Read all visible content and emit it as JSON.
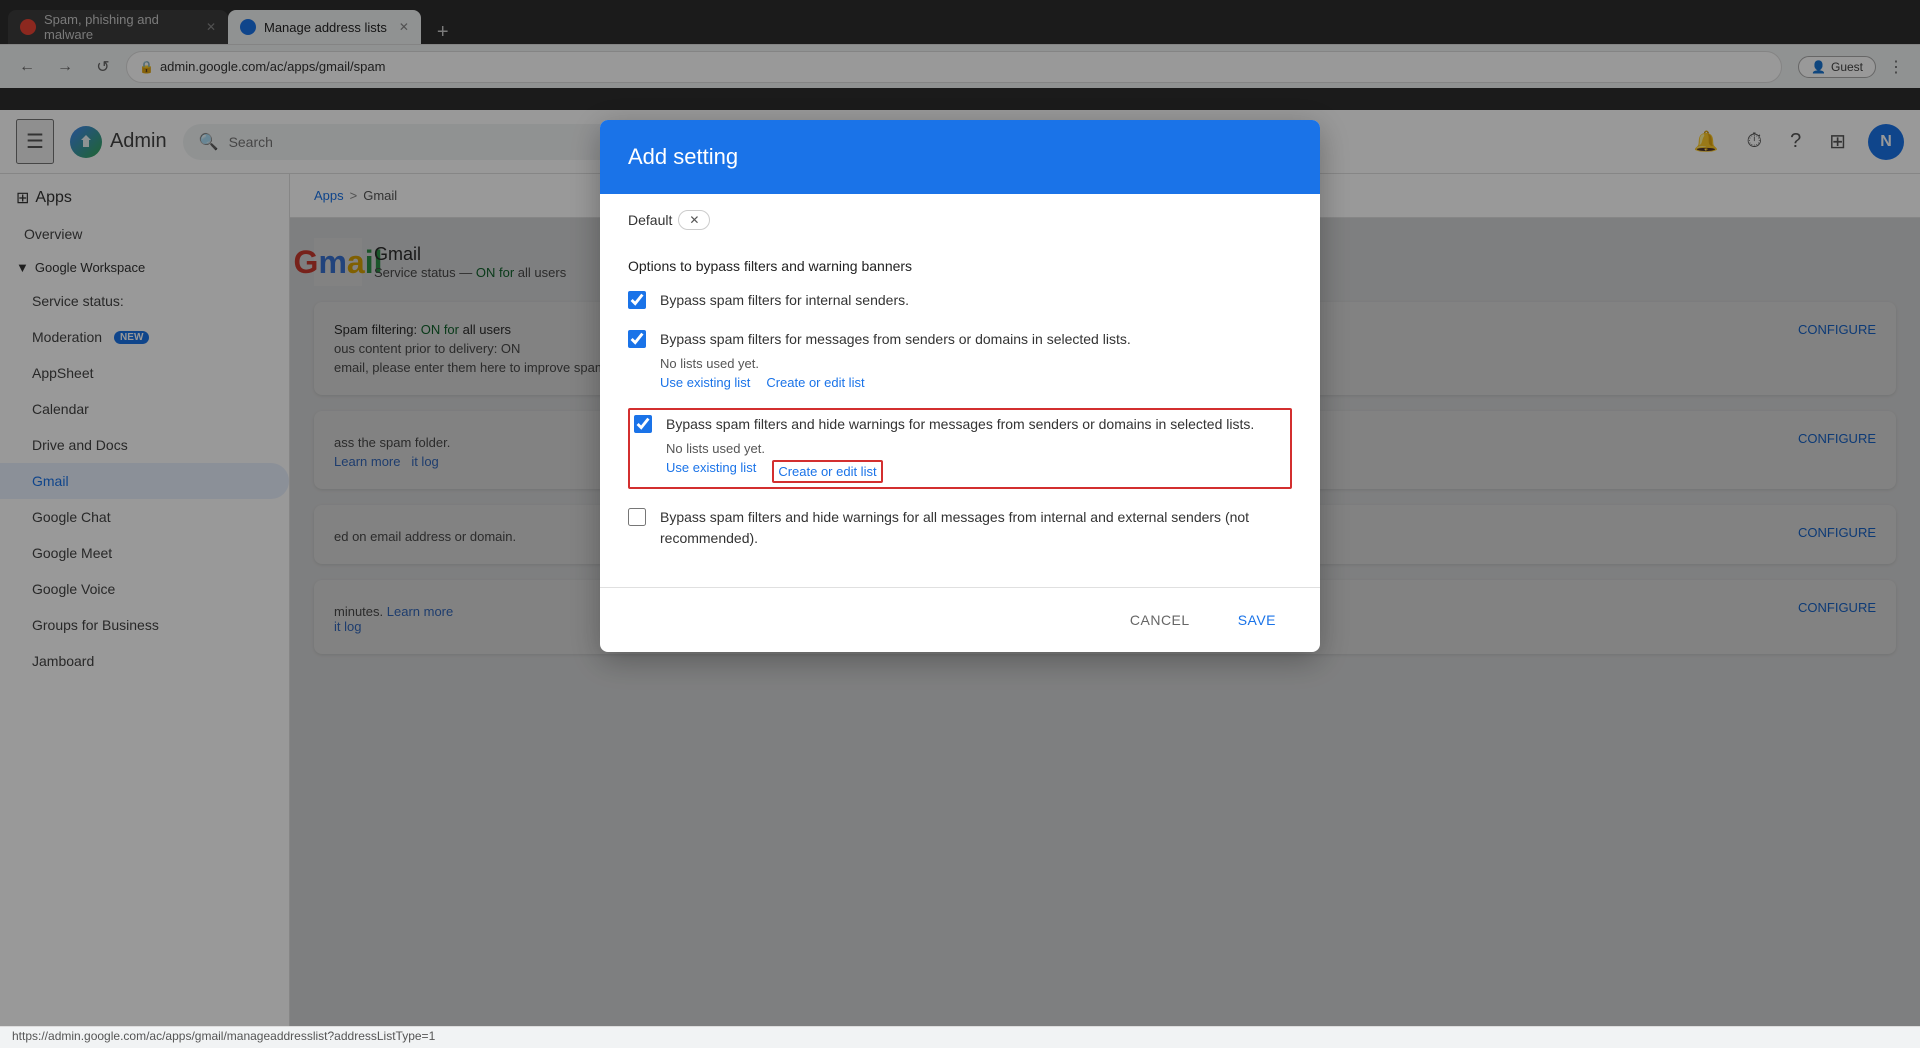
{
  "browser": {
    "tabs": [
      {
        "id": "tab1",
        "label": "Spam, phishing and malware",
        "favicon_type": "orange",
        "active": false
      },
      {
        "id": "tab2",
        "label": "Manage address lists",
        "favicon_type": "blue",
        "active": true
      }
    ],
    "new_tab_label": "+",
    "address": "admin.google.com/ac/apps/gmail/spam",
    "lock_icon": "🔒",
    "back_icon": "←",
    "forward_icon": "→",
    "reload_icon": "↺",
    "menu_icon": "⋮",
    "guest_label": "Guest",
    "extensions_icon": "⚙"
  },
  "topnav": {
    "hamburger_icon": "☰",
    "logo_text": "Admin",
    "search_placeholder": "Search",
    "bell_icon": "🔔",
    "timer_icon": "⏱",
    "help_icon": "?",
    "grid_icon": "⊞",
    "avatar_label": "N"
  },
  "sidebar": {
    "apps_label": "Apps",
    "apps_icon": "⊞",
    "overview_label": "Overview",
    "google_workspace_label": "Google Workspace",
    "service_status_label": "Service status:",
    "moderation_label": "Moderation",
    "moderation_badge": "NEW",
    "appsheet_label": "AppSheet",
    "calendar_label": "Calendar",
    "drive_docs_label": "Drive and Docs",
    "gmail_label": "Gmail",
    "google_chat_label": "Google Chat",
    "google_meet_label": "Google Meet",
    "google_voice_label": "Google Voice",
    "groups_label": "Groups for Business",
    "jamboard_label": "Jamboard"
  },
  "breadcrumb": {
    "apps_label": "Apps",
    "separator": ">",
    "gmail_label": "Gmail"
  },
  "main": {
    "configure_label": "CONFIGURE",
    "content_on_text": "ON for",
    "spam_text": "ass the spam folder.",
    "learn_more": "Learn more",
    "it_log": "it log",
    "bypass_text": "ous content prior to delivery: ON",
    "email_improve_text": "email, please enter them here to improve spam",
    "address_domain_text": "ed on email address or domain.",
    "minutes_text": "minutes. Learn more",
    "it_log2": "it log",
    "minutes_text2": "minutes. Learn more",
    "it_log3": "it log"
  },
  "modal": {
    "title": "Add setting",
    "default_label": "Default",
    "section_title": "Options to bypass filters and warning banners",
    "checkbox1": {
      "label": "Bypass spam filters for internal senders.",
      "checked": true,
      "highlighted": false
    },
    "checkbox2": {
      "label": "Bypass spam filters for messages from senders or domains in selected lists.",
      "checked": true,
      "highlighted": false,
      "no_lists_text": "No lists used yet.",
      "link1": "Use existing list",
      "link2": "Create or edit list"
    },
    "checkbox3": {
      "label": "Bypass spam filters and hide warnings for messages from senders or domains in selected lists.",
      "checked": true,
      "highlighted": true,
      "no_lists_text": "No lists used yet.",
      "link1": "Use existing list",
      "link2": "Create or edit list"
    },
    "checkbox4": {
      "label": "Bypass spam filters and hide warnings for all messages from internal and external senders (not recommended).",
      "checked": false,
      "highlighted": false
    },
    "cancel_label": "CANCEL",
    "save_label": "SAVE"
  },
  "statusbar": {
    "url": "https://admin.google.com/ac/apps/gmail/manageaddresslist?addressListType=1"
  }
}
